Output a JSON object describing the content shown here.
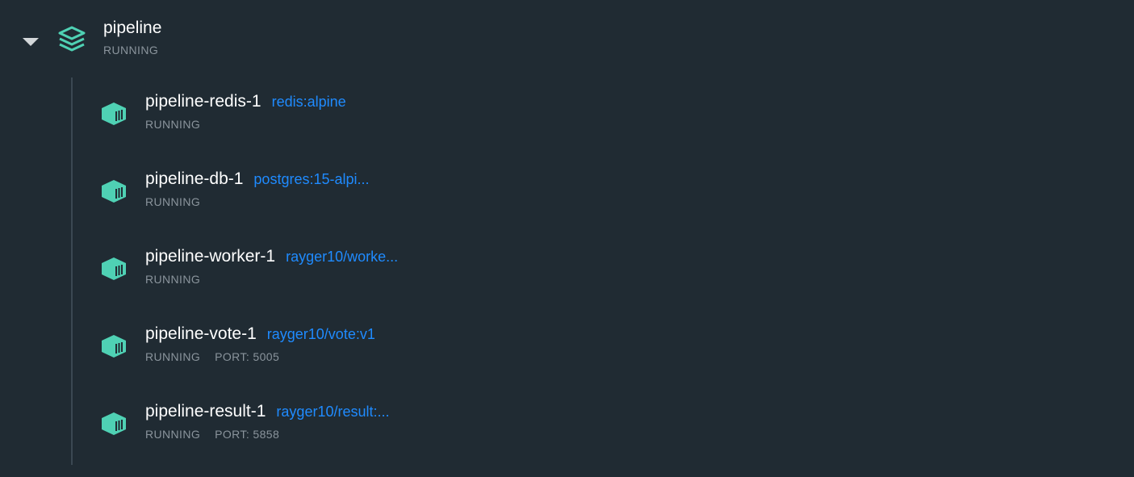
{
  "group": {
    "name": "pipeline",
    "status": "RUNNING",
    "icon": "stack-icon",
    "toggle_icon": "chevron-down-icon"
  },
  "containers": [
    {
      "name": "pipeline-redis-1",
      "image": "redis:alpine",
      "status": "RUNNING",
      "port": ""
    },
    {
      "name": "pipeline-db-1",
      "image": "postgres:15-alpi...",
      "status": "RUNNING",
      "port": ""
    },
    {
      "name": "pipeline-worker-1",
      "image": "rayger10/worke...",
      "status": "RUNNING",
      "port": ""
    },
    {
      "name": "pipeline-vote-1",
      "image": "rayger10/vote:v1",
      "status": "RUNNING",
      "port": "PORT: 5005"
    },
    {
      "name": "pipeline-result-1",
      "image": "rayger10/result:...",
      "status": "RUNNING",
      "port": "PORT: 5858"
    }
  ],
  "colors": {
    "background": "#202b33",
    "accent_green": "#4fd1b4",
    "link_blue": "#1f8bff",
    "status_gray": "#8a949c",
    "text_white": "#ffffff",
    "tree_line": "#3b4852"
  }
}
